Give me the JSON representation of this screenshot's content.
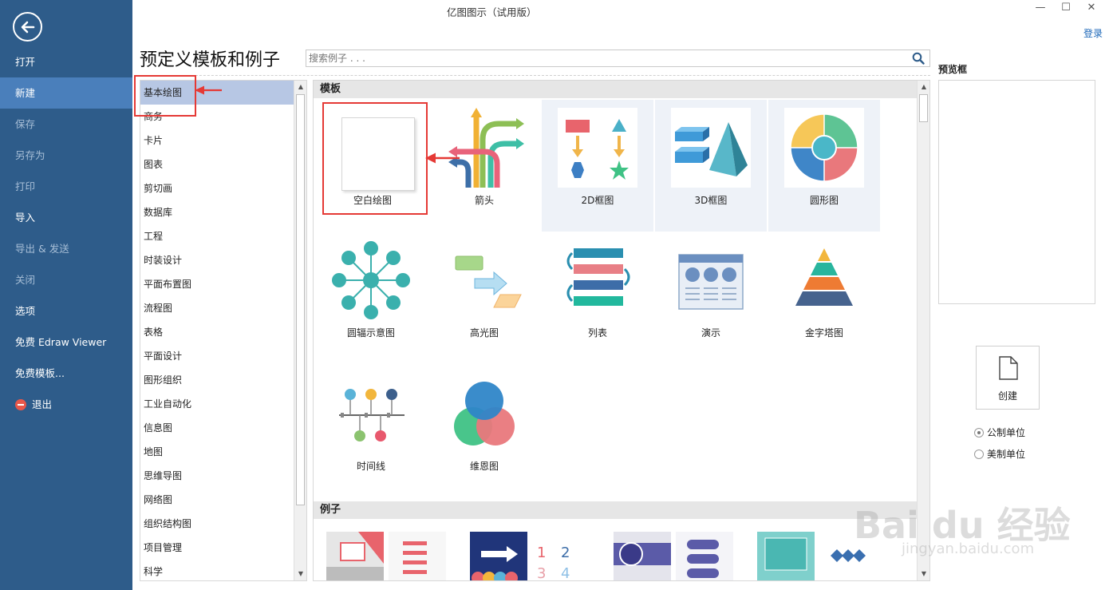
{
  "window": {
    "title": "亿图图示（试用版）",
    "minimize": "—",
    "maximize": "☐",
    "close": "✕",
    "login": "登录"
  },
  "sidebar": {
    "back_icon": "back-arrow-circle-icon",
    "items": [
      {
        "label": "打开",
        "state": "normal"
      },
      {
        "label": "新建",
        "state": "active"
      },
      {
        "label": "保存",
        "state": "disabled"
      },
      {
        "label": "另存为",
        "state": "disabled"
      },
      {
        "label": "打印",
        "state": "disabled"
      },
      {
        "label": "导入",
        "state": "normal"
      },
      {
        "label": "导出 & 发送",
        "state": "disabled"
      },
      {
        "label": "关闭",
        "state": "disabled"
      },
      {
        "label": "选项",
        "state": "normal"
      },
      {
        "label": "免费 Edraw Viewer",
        "state": "normal"
      },
      {
        "label": "免费模板...",
        "state": "normal"
      },
      {
        "label": "退出",
        "state": "normal"
      }
    ],
    "colors": {
      "background": "#2e5c8a",
      "active": "#4a7fbb"
    }
  },
  "main": {
    "heading": "预定义模板和例子",
    "search": {
      "placeholder": "搜索例子 . . .",
      "icon": "search-icon"
    },
    "categories": [
      "基本绘图",
      "商务",
      "卡片",
      "图表",
      "剪切画",
      "数据库",
      "工程",
      "时装设计",
      "平面布置图",
      "流程图",
      "表格",
      "平面设计",
      "图形组织",
      "工业自动化",
      "信息图",
      "地图",
      "思维导图",
      "网络图",
      "组织结构图",
      "项目管理",
      "科学"
    ],
    "selected_category": "基本绘图",
    "templates_header": "模板",
    "templates": [
      "空白绘图",
      "箭头",
      "2D框图",
      "3D框图",
      "圆形图",
      "圆辐示意图",
      "高光图",
      "列表",
      "演示",
      "金字塔图",
      "时间线",
      "维恩图"
    ],
    "examples_header": "例子"
  },
  "preview": {
    "label": "预览框",
    "create_label": "创建",
    "units": [
      {
        "label": "公制单位",
        "checked": true
      },
      {
        "label": "美制单位",
        "checked": false
      }
    ]
  },
  "watermark": {
    "text": "Bai du 经验",
    "url": "jingyan.baidu.com"
  }
}
